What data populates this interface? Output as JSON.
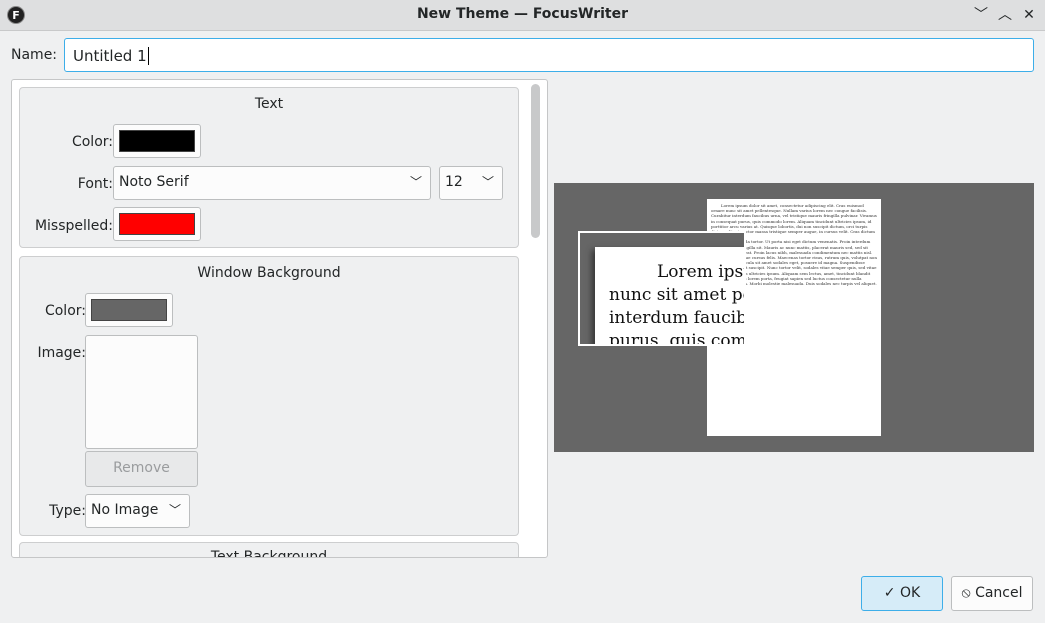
{
  "window": {
    "title": "New Theme — FocusWriter",
    "app_icon": "F",
    "minimize": "﹀",
    "maximize": "︿",
    "close": "✕"
  },
  "name": {
    "label": "Name:",
    "value": "Untitled 1"
  },
  "text_group": {
    "title": "Text",
    "color_label": "Color:",
    "font_label": "Font:",
    "font_value": "Noto Serif",
    "size_value": "12",
    "misspelled_label": "Misspelled:",
    "text_color": "#000000",
    "misspelled_color": "#ff0000"
  },
  "window_bg": {
    "title": "Window Background",
    "color_label": "Color:",
    "image_label": "Image:",
    "remove_label": "Remove",
    "type_label": "Type:",
    "type_value": "No Image",
    "color": "#666666"
  },
  "text_bg": {
    "title": "Text Background"
  },
  "preview": {
    "large_lines": [
      "Lorem ipsu",
      "nunc sit amet pell",
      "interdum faucibu",
      "purus, quis comm"
    ],
    "small_text_1": "Lorem ipsum dolor sit amet, consectetur adipiscing elit. Cras euismod ornare nunc sit amet pellentesque. Nullam varius lorem nec congue facilisis. Curabitur interdum faucibus urna, vel tristique mauris fringilla pulvinar. Vivamus in consequat purus, quis commodo lorem. Aliquam tincidunt ultricies ipsum, id porttitor arcu varius at. Quisque lobortis, dui non suscipit dictum, orci turpis dictum elit, ut auctor massa tristique semper augue, in cursus velit. Cras dictum nunc nec nibh.",
    "small_text_2": "Morbi gravida tortor. Ut porta nisi eget dictum venenatis. Proin interdum turpis magna fringilla sit. Mauris ac nunc mattis, placerat mauris sed, sed sit amet vulputate erat. Proin lacus nibh, malesuada condimentum nec mattis nisl. Morbi pellentesque cursus felis. Maecenas tortor risus, rutrum quis, volutpat non nulla. Nunc, vehicula sit amet sodales eget, posuere id magna. Suspendisse ornare id tellus et suscipit. Nunc tortor velit, sodales vitae semper quis, sed vitae laoreet nunc, quis ultricies ipsum. Aliquam sem lectus, amet, tincidunt blandit justo. Praesent at lorem porta, feugiat sapien sed luctus consectetur nulla viverra bibendum. Morbi molestie malesuada. Duis sodales nec turpis vel aliquet."
  },
  "buttons": {
    "ok": "OK",
    "ok_icon": "✓",
    "cancel": "Cancel",
    "cancel_icon": "⦸"
  }
}
